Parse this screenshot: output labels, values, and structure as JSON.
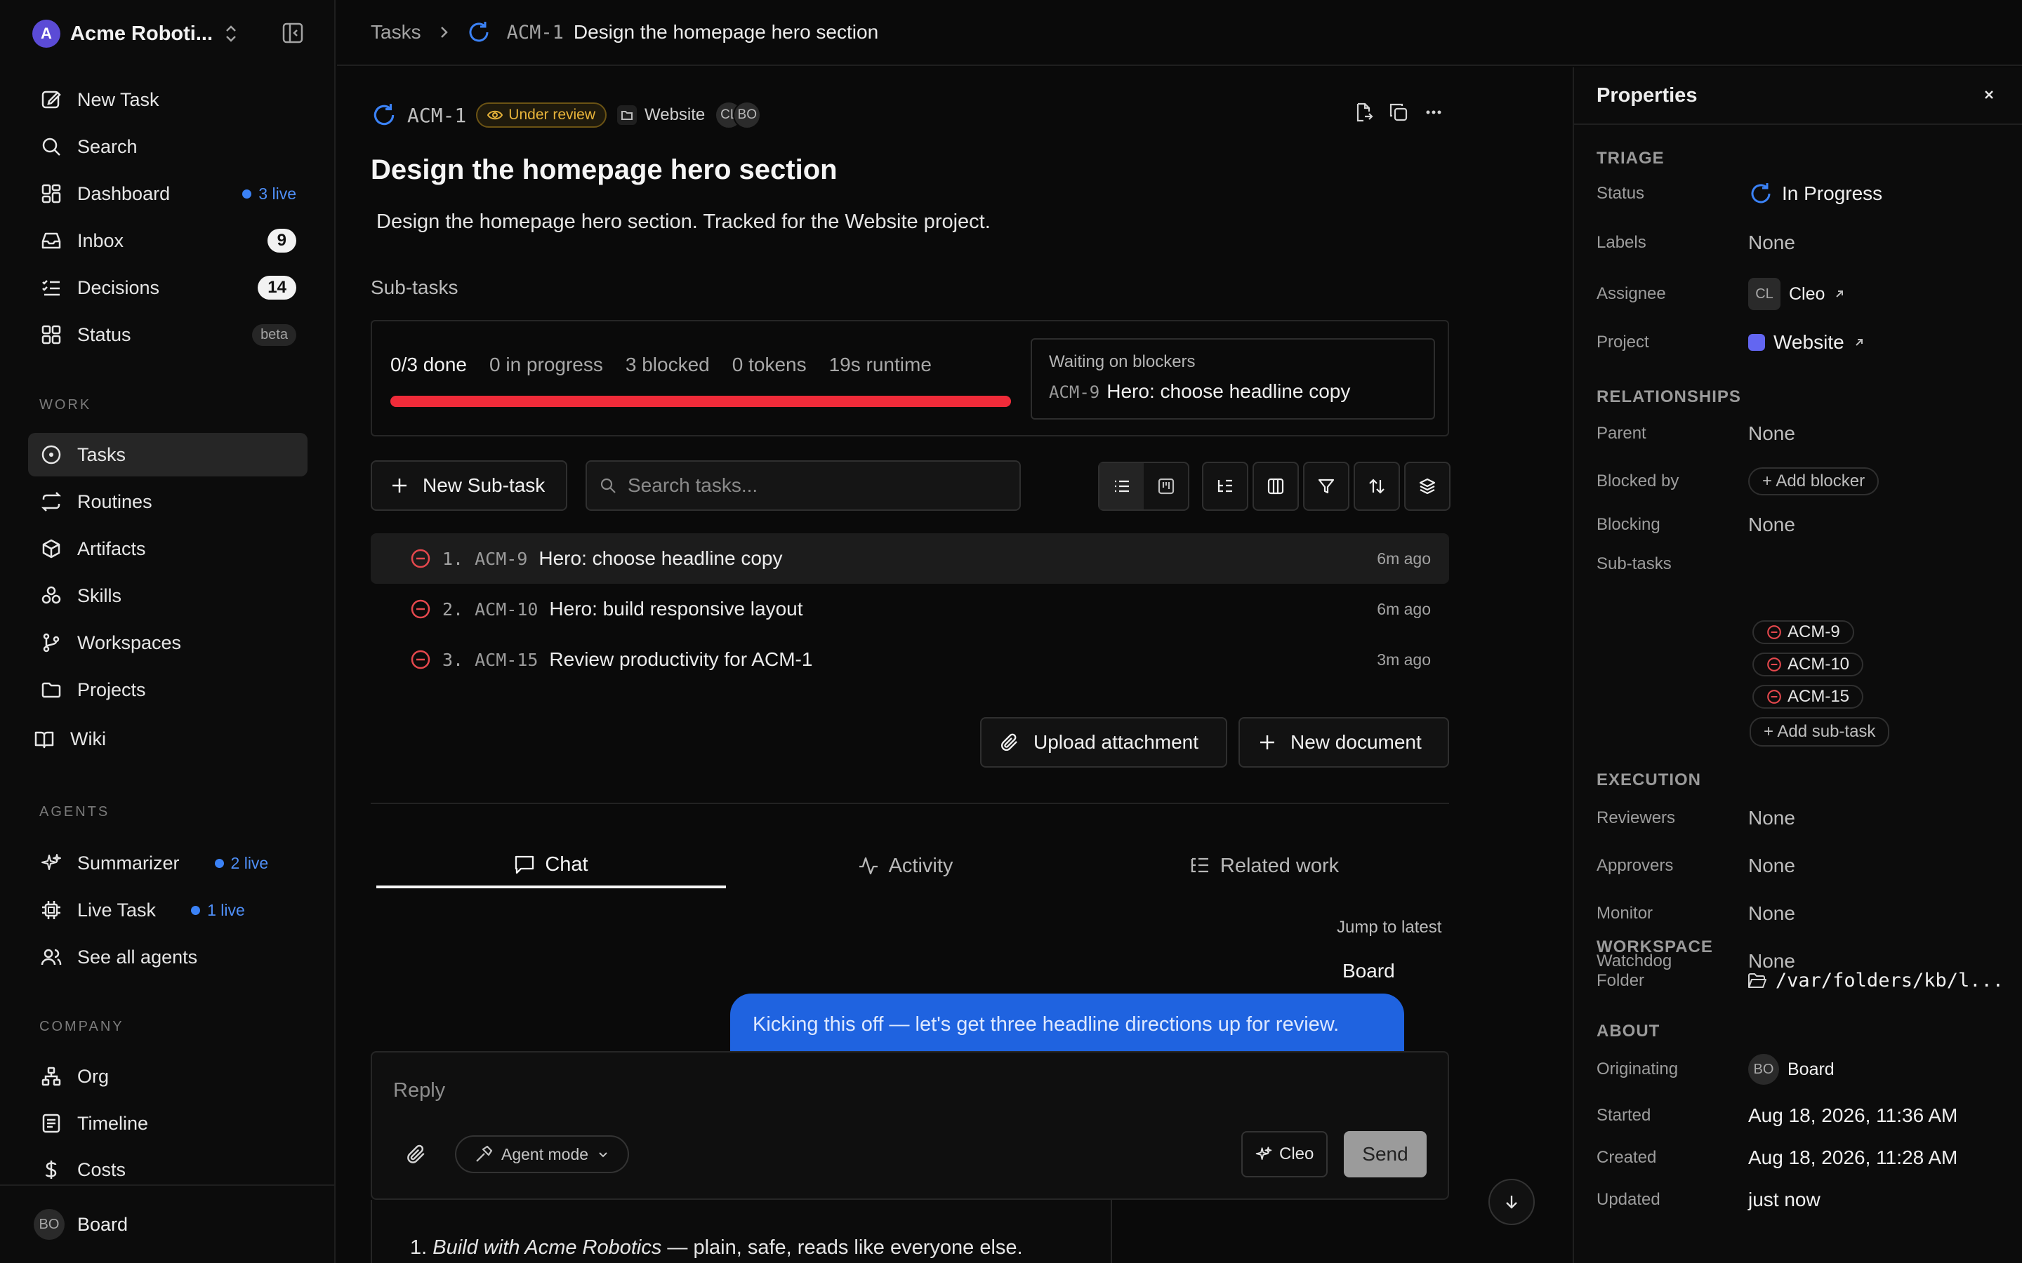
{
  "workspace": {
    "name": "Acme Roboti...",
    "logo_letter": "A"
  },
  "nav": {
    "top": [
      {
        "label": "New Task",
        "icon": "pen-square-icon"
      },
      {
        "label": "Search",
        "icon": "search-icon"
      },
      {
        "label": "Dashboard",
        "icon": "dashboard-icon",
        "live": "3 live"
      },
      {
        "label": "Inbox",
        "icon": "inbox-icon",
        "count": "9"
      },
      {
        "label": "Decisions",
        "icon": "checklist-icon",
        "count": "14"
      },
      {
        "label": "Status",
        "icon": "grid-icon",
        "badge": "beta"
      }
    ],
    "work_label": "WORK",
    "work": [
      {
        "label": "Tasks",
        "icon": "target-icon",
        "active": true
      },
      {
        "label": "Routines",
        "icon": "repeat-icon"
      },
      {
        "label": "Artifacts",
        "icon": "box-icon"
      },
      {
        "label": "Skills",
        "icon": "blocks-icon"
      },
      {
        "label": "Workspaces",
        "icon": "git-branch-icon"
      },
      {
        "label": "Projects",
        "icon": "folder-icon"
      },
      {
        "label": "Wiki",
        "icon": "book-icon"
      }
    ],
    "agents_label": "AGENTS",
    "agents": [
      {
        "label": "Summarizer",
        "icon": "sparkles-icon",
        "live": "2 live"
      },
      {
        "label": "Live Task",
        "icon": "cpu-icon",
        "live": "1 live"
      },
      {
        "label": "See all agents",
        "icon": "users-icon"
      }
    ],
    "company_label": "COMPANY",
    "company": [
      {
        "label": "Org",
        "icon": "org-icon"
      },
      {
        "label": "Timeline",
        "icon": "timeline-icon"
      },
      {
        "label": "Costs",
        "icon": "dollar-icon"
      }
    ],
    "footer": {
      "avatar": "BO",
      "label": "Board"
    }
  },
  "breadcrumb": {
    "root": "Tasks",
    "key": "ACM-1",
    "title": "Design the homepage hero section"
  },
  "task": {
    "key": "ACM-1",
    "status_badge": "Under review",
    "project": "Website",
    "avatars": [
      "CL",
      "BO"
    ],
    "title": "Design the homepage hero section",
    "description": "Design the homepage hero section. Tracked for the Website project."
  },
  "subtasks": {
    "label": "Sub-tasks",
    "stats": {
      "done": "0/3 done",
      "in_progress": "0 in progress",
      "blocked": "3 blocked",
      "tokens": "0 tokens",
      "runtime": "19s runtime"
    },
    "progress": 1.0,
    "progress_color": "#ef2b39",
    "blockers": {
      "title": "Waiting on blockers",
      "key": "ACM-9",
      "text": "Hero: choose headline copy"
    },
    "new_button": "New Sub-task",
    "search_placeholder": "Search tasks...",
    "items": [
      {
        "num": "1.",
        "key": "ACM-9",
        "title": "Hero: choose headline copy",
        "time": "6m ago"
      },
      {
        "num": "2.",
        "key": "ACM-10",
        "title": "Hero: build responsive layout",
        "time": "6m ago"
      },
      {
        "num": "3.",
        "key": "ACM-15",
        "title": "Review productivity for ACM-1",
        "time": "3m ago"
      }
    ]
  },
  "actions": {
    "upload": "Upload attachment",
    "new_doc": "New document"
  },
  "tabs": [
    {
      "label": "Chat",
      "icon": "chat-icon"
    },
    {
      "label": "Activity",
      "icon": "activity-icon"
    },
    {
      "label": "Related work",
      "icon": "list-tree-icon"
    }
  ],
  "chat": {
    "jump": "Jump to latest",
    "sender": "Board",
    "message": "Kicking this off — let's get three headline directions up for review.",
    "reply_placeholder": "Reply",
    "agent_mode": "Agent mode",
    "agent": "Cleo",
    "send": "Send",
    "list_num": "1.",
    "list_em": "Build with Acme Robotics",
    "list_rest": " — plain, safe, reads like everyone else."
  },
  "properties": {
    "title": "Properties",
    "triage_label": "TRIAGE",
    "status_k": "Status",
    "status_v": "In Progress",
    "labels_k": "Labels",
    "labels_v": "None",
    "assignee_k": "Assignee",
    "assignee_av": "CL",
    "assignee_v": "Cleo",
    "project_k": "Project",
    "project_v": "Website",
    "project_color": "#6366f1",
    "rel_label": "RELATIONSHIPS",
    "parent_k": "Parent",
    "parent_v": "None",
    "blockedby_k": "Blocked by",
    "blockedby_v": "+ Add blocker",
    "blocking_k": "Blocking",
    "blocking_v": "None",
    "subtasks_k": "Sub-tasks",
    "subtasks": [
      "ACM-9",
      "ACM-10",
      "ACM-15"
    ],
    "add_subtask": "+ Add sub-task",
    "exec_label": "EXECUTION",
    "reviewers_k": "Reviewers",
    "reviewers_v": "None",
    "approvers_k": "Approvers",
    "approvers_v": "None",
    "monitor_k": "Monitor",
    "monitor_v": "None",
    "watchdog_k": "Watchdog",
    "watchdog_v": "None",
    "workspace_label": "WORKSPACE",
    "folder_k": "Folder",
    "folder_v": "/var/folders/kb/l...",
    "about_label": "ABOUT",
    "orig_k": "Originating",
    "orig_av": "BO",
    "orig_v": "Board",
    "started_k": "Started",
    "started_v": "Aug 18, 2026, 11:36 AM",
    "created_k": "Created",
    "created_v": "Aug 18, 2026, 11:28 AM",
    "updated_k": "Updated",
    "updated_v": "just now"
  }
}
